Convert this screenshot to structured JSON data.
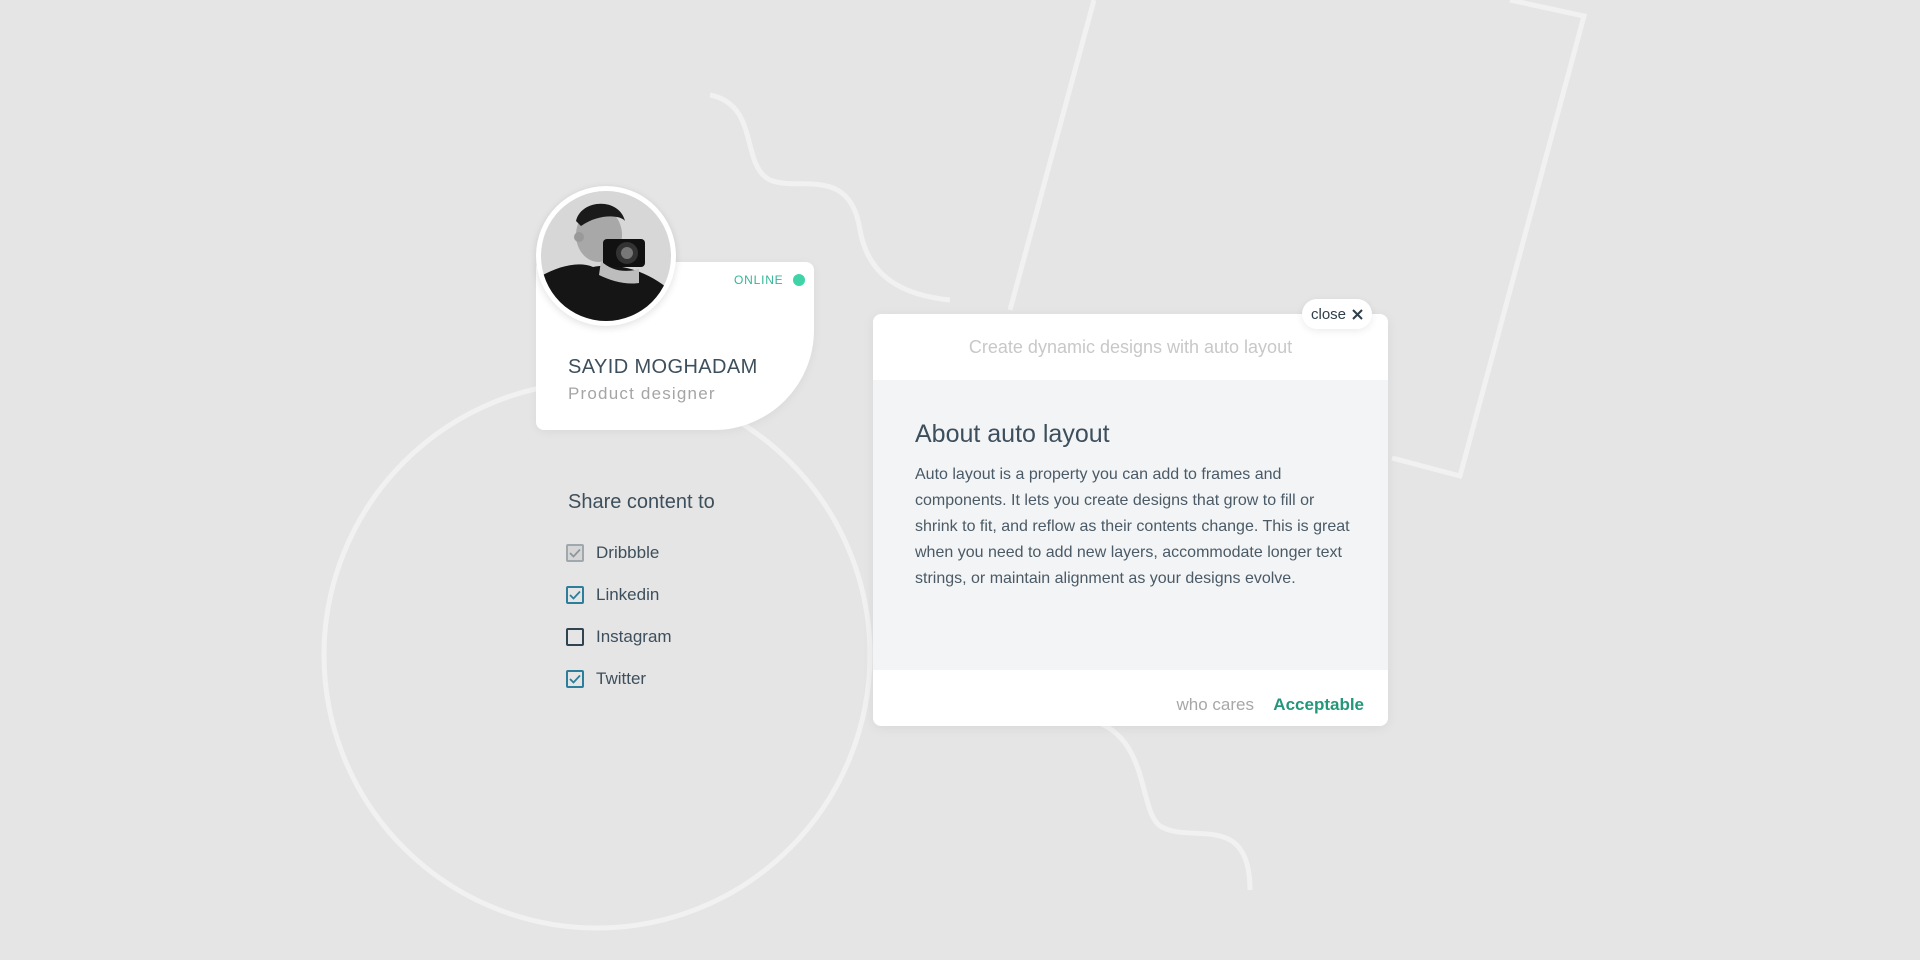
{
  "profile": {
    "status": "ONLINE",
    "name": "SAYID MOGHADAM",
    "role": "Product designer"
  },
  "share": {
    "title": "Share content to",
    "items": [
      {
        "label": "Dribbble",
        "state": "disabled-checked"
      },
      {
        "label": "Linkedin",
        "state": "checked"
      },
      {
        "label": "Instagram",
        "state": "unchecked"
      },
      {
        "label": "Twitter",
        "state": "checked"
      }
    ]
  },
  "dialog": {
    "header": "Create dynamic designs with auto layout",
    "title": "About auto layout",
    "body": "Auto layout is a property you can add to frames and components. It lets you create designs that grow to fill or shrink to fit, and reflow as their contents change. This is great when you need to add new layers, accommodate longer text strings, or maintain alignment as your designs evolve.",
    "secondary_action": "who cares",
    "primary_action": "Acceptable",
    "close_label": "close"
  },
  "colors": {
    "background": "#e5e5e5",
    "accent_green": "#24977b",
    "online_dot": "#3fd4a8",
    "checkbox_checked": "#2d7e9b",
    "text_dark": "#3d4f5c"
  },
  "icons": {
    "close": "close-icon",
    "check": "check-icon",
    "status": "online-dot-icon"
  }
}
